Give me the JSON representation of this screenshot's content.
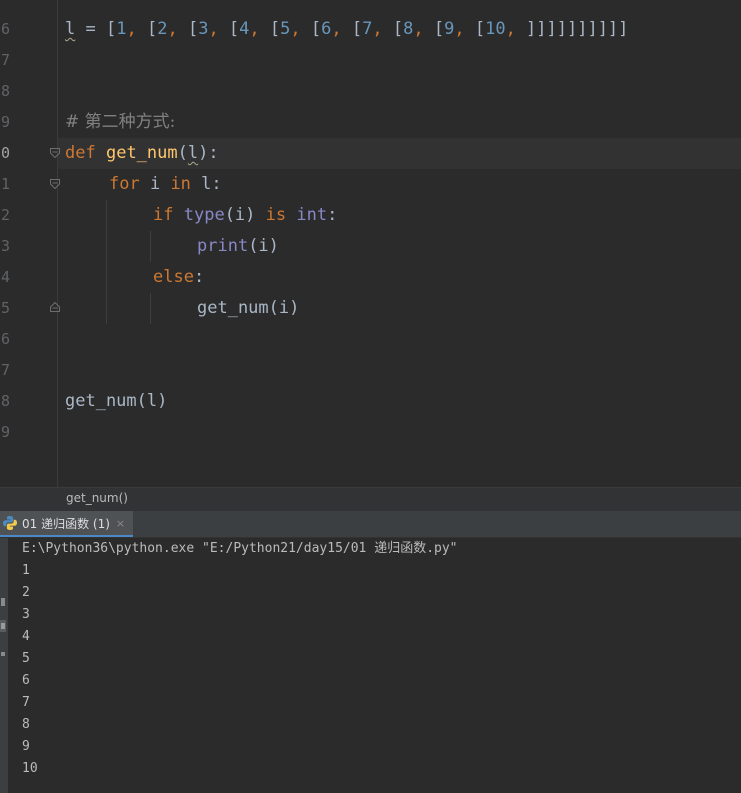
{
  "editor": {
    "line_numbers": [
      "6",
      "7",
      "8",
      "9",
      "0",
      "1",
      "2",
      "3",
      "4",
      "5",
      "6",
      "7",
      "8",
      "9"
    ],
    "current_line_number": "0",
    "code": {
      "list_var": "l",
      "list_eq": " = ",
      "list_tokens": [
        "[",
        "1",
        ", ",
        "[",
        "2",
        ", ",
        "[",
        "3",
        ", ",
        "[",
        "4",
        ", ",
        "[",
        "5",
        ", ",
        "[",
        "6",
        ", ",
        "[",
        "7",
        ", ",
        "[",
        "8",
        ", ",
        "[",
        "9",
        ", ",
        "[",
        "10",
        ", ",
        "]]]]]]]]]]"
      ],
      "comment": "# 第二种方式:",
      "def_kw": "def",
      "func_name": "get_num",
      "param_open": "(",
      "param": "l",
      "param_close": "):",
      "for_kw": "for",
      "for_var": " i ",
      "in_kw": "in",
      "for_iter": " l:",
      "if_kw": "if",
      "type_fn": "type",
      "type_arg": "(i) ",
      "is_kw": "is",
      "int_fn": "int",
      "if_colon": ":",
      "print_fn": "print",
      "print_arg": "(i)",
      "else_kw": "else",
      "else_colon": ":",
      "recursive_call": "get_num(i)",
      "final_call": "get_num(l)"
    }
  },
  "breadcrumb": {
    "label": "get_num()"
  },
  "run": {
    "tab_label": "01 递归函数 (1)",
    "tab_close": "×",
    "command": "E:\\Python36\\python.exe \"E:/Python21/day15/01 递归函数.py\"",
    "output": [
      "1",
      "2",
      "3",
      "4",
      "5",
      "6",
      "7",
      "8",
      "9",
      "10"
    ]
  },
  "colors": {
    "keyword": "#cc7832",
    "function": "#ffc66d",
    "builtin": "#8888c6",
    "number": "#6897bb",
    "comment": "#808080",
    "text": "#a9b7c6",
    "background": "#2b2b2b"
  }
}
